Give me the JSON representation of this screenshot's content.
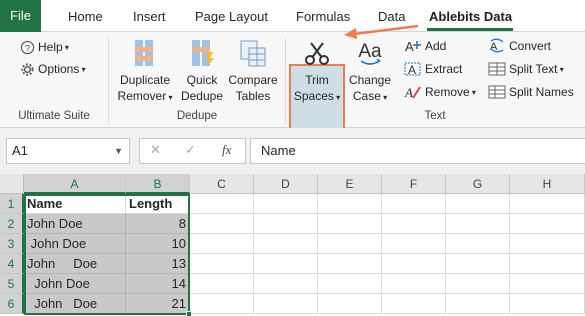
{
  "tabs": {
    "file": "File",
    "home": "Home",
    "insert": "Insert",
    "page_layout": "Page Layout",
    "formulas": "Formulas",
    "data": "Data",
    "ablebits_data": "Ablebits Data"
  },
  "ribbon": {
    "ultimate_suite": {
      "help": "Help",
      "options": "Options",
      "label": "Ultimate Suite"
    },
    "dedupe": {
      "duplicate_line1": "Duplicate",
      "duplicate_line2": "Remover",
      "quick_line1": "Quick",
      "quick_line2": "Dedupe",
      "compare_line1": "Compare",
      "compare_line2": "Tables",
      "label": "Dedupe"
    },
    "text": {
      "trim_line1": "Trim",
      "trim_line2": "Spaces",
      "change_line1": "Change",
      "change_line2": "Case",
      "add": "Add",
      "extract": "Extract",
      "remove": "Remove",
      "convert": "Convert",
      "split_text": "Split Text",
      "split_names": "Split Names",
      "label": "Text"
    }
  },
  "formula_bar": {
    "name_box": "A1",
    "fx": "fx",
    "value": "Name"
  },
  "sheet": {
    "columns": [
      "A",
      "B",
      "C",
      "D",
      "E",
      "F",
      "G",
      "H"
    ],
    "rows": [
      "1",
      "2",
      "3",
      "4",
      "5",
      "6"
    ],
    "header": [
      "Name",
      "Length"
    ],
    "data": [
      [
        "John Doe",
        "8"
      ],
      [
        " John Doe",
        "10"
      ],
      [
        "John     Doe",
        "13"
      ],
      [
        "  John Doe",
        "14"
      ],
      [
        "  John   Doe",
        "21"
      ]
    ]
  },
  "colors": {
    "excel_green": "#217346",
    "highlight": "#ed7d4e",
    "selection_fill": "#c9c9c9"
  }
}
